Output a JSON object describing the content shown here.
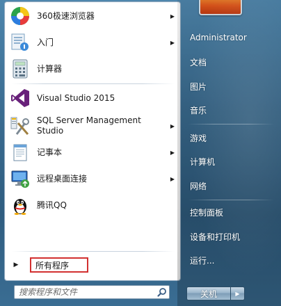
{
  "programs": {
    "browser": {
      "label": "360极速浏览器",
      "icon": "browser-360-icon"
    },
    "getting_started": {
      "label": "入门",
      "icon": "getting-started-icon"
    },
    "calculator": {
      "label": "计算器",
      "icon": "calculator-icon"
    },
    "visual_studio": {
      "label": "Visual Studio 2015",
      "icon": "visual-studio-icon"
    },
    "sql_server": {
      "label": "SQL Server Management Studio",
      "icon": "sql-server-icon"
    },
    "notepad": {
      "label": "记事本",
      "icon": "notepad-icon"
    },
    "remote_desktop": {
      "label": "远程桌面连接",
      "icon": "remote-desktop-icon"
    },
    "qq": {
      "label": "腾讯QQ",
      "icon": "qq-penguin-icon"
    }
  },
  "all_programs": {
    "label": "所有程序"
  },
  "search": {
    "placeholder": "搜索程序和文件"
  },
  "right": {
    "user": "Administrator",
    "documents": "文档",
    "pictures": "图片",
    "music": "音乐",
    "games": "游戏",
    "computer": "计算机",
    "network": "网络",
    "control_panel": "控制面板",
    "devices_printers": "设备和打印机",
    "run": "运行..."
  },
  "shutdown": {
    "label": "关机"
  },
  "colors": {
    "highlight_box": "#d23030",
    "panel_blue": "#3b6d92"
  }
}
